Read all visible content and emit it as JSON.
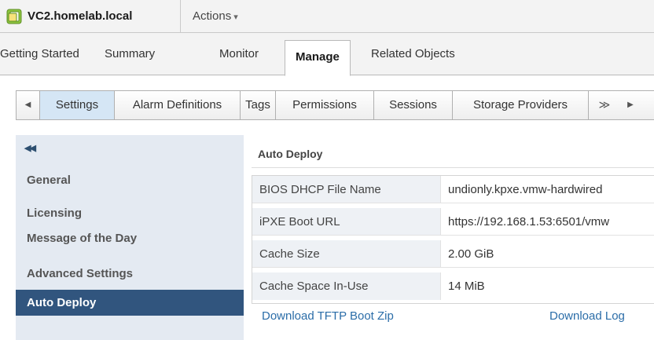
{
  "window": {
    "title": "VC2.homelab.local",
    "actions_label": "Actions",
    "actions_caret": "▾"
  },
  "tabs": [
    {
      "label": "Getting Started"
    },
    {
      "label": "Summary"
    },
    {
      "label": "Monitor"
    },
    {
      "label": "Manage",
      "active": true
    },
    {
      "label": "Related Objects"
    }
  ],
  "subtabs": {
    "prev_arrow": "◀",
    "next_arrow": "▶",
    "more": "≫",
    "items": [
      {
        "label": "Settings",
        "active": true
      },
      {
        "label": "Alarm Definitions"
      },
      {
        "label": "Tags"
      },
      {
        "label": "Permissions"
      },
      {
        "label": "Sessions"
      },
      {
        "label": "Storage Providers"
      }
    ]
  },
  "sidebar": {
    "collapse_glyph": "◀◀",
    "items": [
      {
        "label": "General"
      },
      {
        "label": "Licensing"
      },
      {
        "label": "Message of the Day"
      },
      {
        "label": "Advanced Settings"
      },
      {
        "label": "Auto Deploy",
        "active": true
      }
    ]
  },
  "content": {
    "section_title": "Auto Deploy",
    "properties": [
      {
        "label": "BIOS DHCP File Name",
        "value": "undionly.kpxe.vmw-hardwired"
      },
      {
        "label": "iPXE Boot URL",
        "value": "https://192.168.1.53:6501/vmw"
      },
      {
        "label": "Cache Size",
        "value": "2.00 GiB"
      },
      {
        "label": "Cache Space In-Use",
        "value": "14 MiB"
      }
    ],
    "download_tftp_label": "Download TFTP Boot Zip",
    "download_log_label": "Download Log"
  },
  "colors": {
    "nav_active_bg": "#31557e",
    "subtab_active_bg": "#d5e6f5",
    "link": "#2b6da8",
    "sidebar_bg": "#e4eaf2"
  }
}
